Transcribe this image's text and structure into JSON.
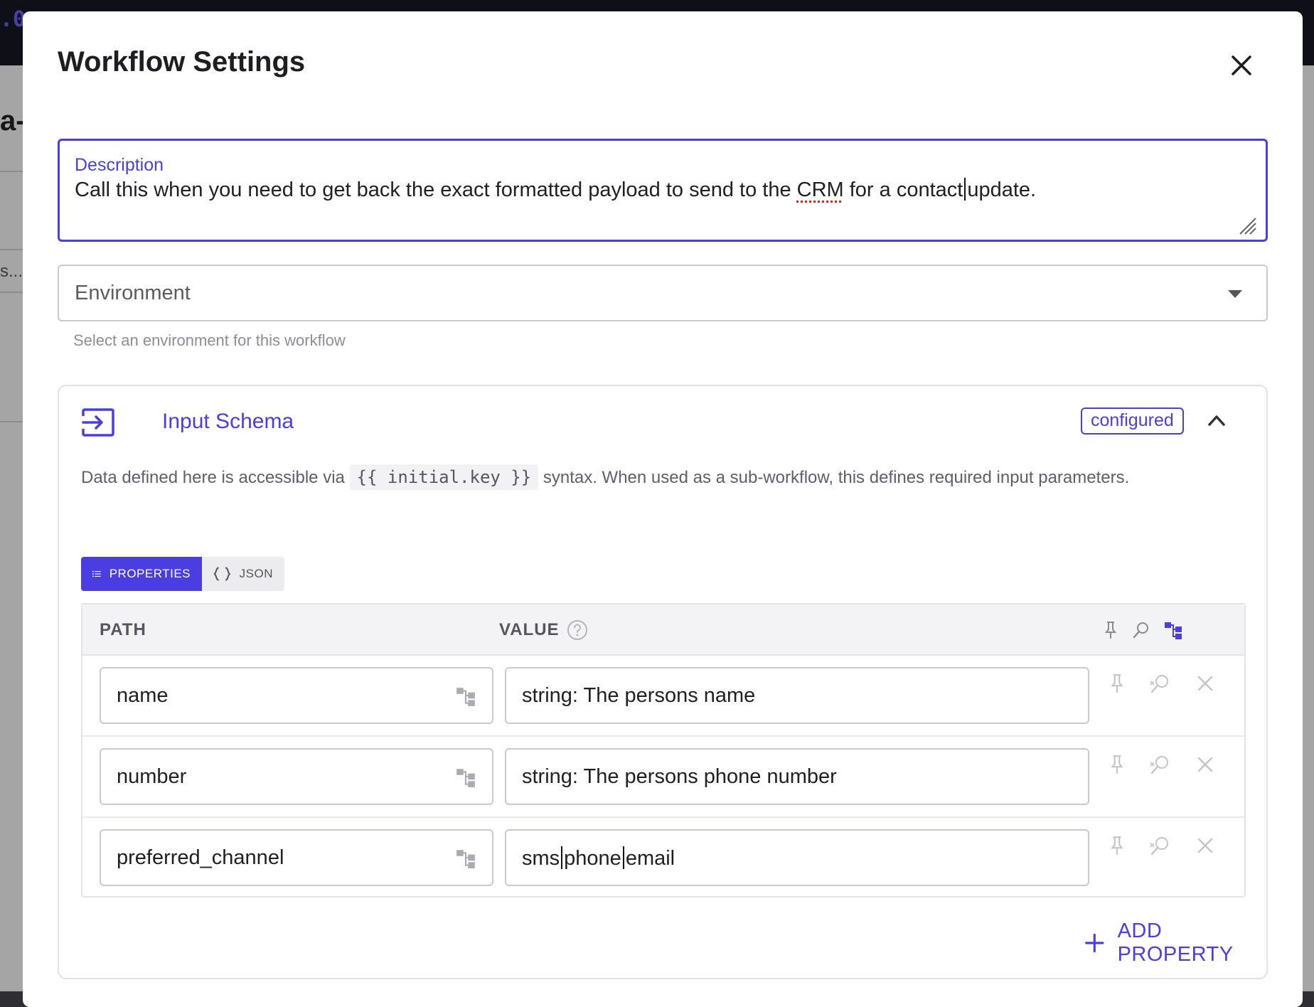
{
  "backdrop": {
    "brand_fragment": ".0",
    "title_fragment": "a-",
    "ellipsis": "s..."
  },
  "modal": {
    "title": "Workflow Settings",
    "close_icon": "close-icon"
  },
  "description": {
    "label": "Description",
    "text_before_flag": "Call this when you need to get back the exact formatted payload to send to the ",
    "flagged_word": "CRM",
    "text_before_caret": " for a contact",
    "text_after_caret": "update."
  },
  "environment": {
    "label": "Environment",
    "helper": "Select an environment for this workflow"
  },
  "input_schema": {
    "title": "Input Schema",
    "badge": "configured",
    "desc_before": "Data defined here is accessible via ",
    "code": "{{ initial.key }}",
    "desc_after": " syntax. When used as a sub-workflow, this defines required input parameters.",
    "tabs": [
      {
        "label": "PROPERTIES",
        "active": true,
        "icon": "list-icon"
      },
      {
        "label": "JSON",
        "active": false,
        "icon": "braces-icon"
      }
    ],
    "table": {
      "col_path": "PATH",
      "col_value": "VALUE",
      "rows": [
        {
          "path": "name",
          "value": "string: The persons name"
        },
        {
          "path": "number",
          "value": "string: The persons phone number"
        },
        {
          "path": "preferred_channel",
          "value_parts": [
            "sms",
            "phone",
            "email"
          ]
        }
      ]
    },
    "add_property_label": "ADD PROPERTY"
  },
  "colors": {
    "accent": "#4a3ee0",
    "text": "#1f1f24",
    "muted": "#8d8d95",
    "border": "#c9c9cf"
  }
}
